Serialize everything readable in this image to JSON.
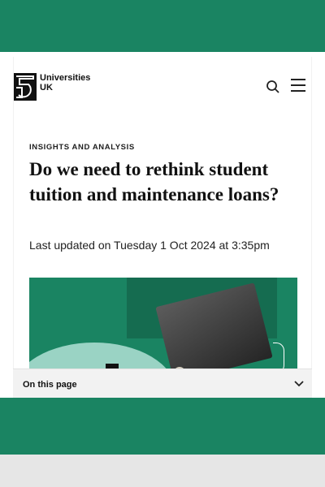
{
  "header": {
    "logo_name": "Universities",
    "logo_name2": "UK",
    "icons": {
      "search": "search-icon",
      "menu": "menu-icon"
    }
  },
  "article": {
    "kicker": "INSIGHTS AND ANALYSIS",
    "title": "Do we need to rethink student tuition and maintenance loans?",
    "updated": "Last updated on Tuesday 1 Oct 2024 at 3:35pm"
  },
  "toc": {
    "label": "On this page",
    "icon": "chevron-down-icon"
  },
  "colors": {
    "brand_green": "#1a8462",
    "light_green": "#9ad3c4",
    "band_grey": "#e6e6e6"
  }
}
